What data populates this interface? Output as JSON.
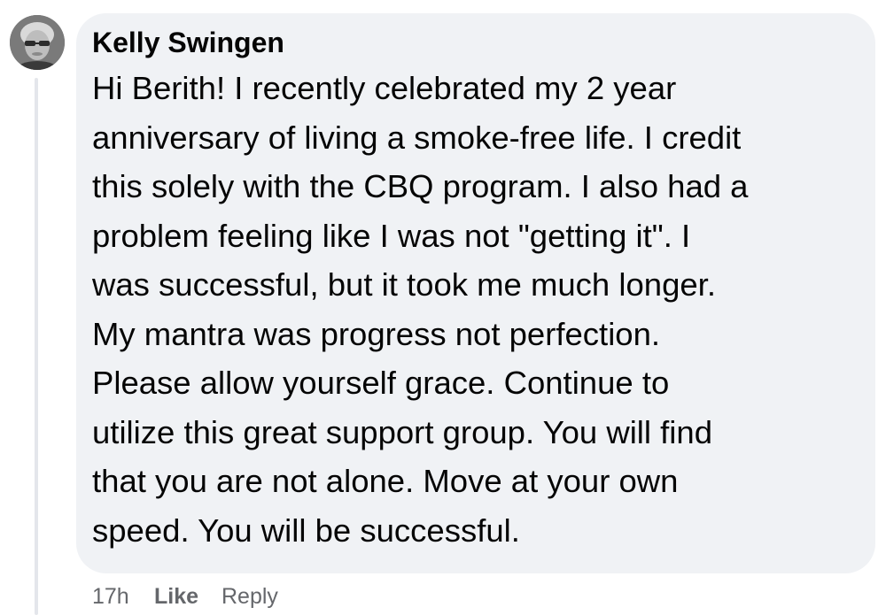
{
  "comment": {
    "author": "Kelly Swingen",
    "lines": [
      "Hi Berith! I recently celebrated my 2 year",
      "anniversary of living a smoke-free life. I credit",
      "this solely with the CBQ program. I also had a",
      "problem feeling like I was not \"getting it\". I",
      "was successful, but it took me much longer.",
      "My mantra was progress not perfection.",
      "Please allow yourself grace. Continue to",
      "utilize this great support group. You will find",
      "that you are not alone. Move at your own",
      "speed. You will be successful."
    ],
    "timestamp": "17h",
    "like_label": "Like",
    "reply_label": "Reply"
  },
  "colors": {
    "bubble": "#f0f2f5",
    "text": "#050505",
    "secondary_text": "#65676b",
    "thread_line": "#e4e6eb"
  }
}
